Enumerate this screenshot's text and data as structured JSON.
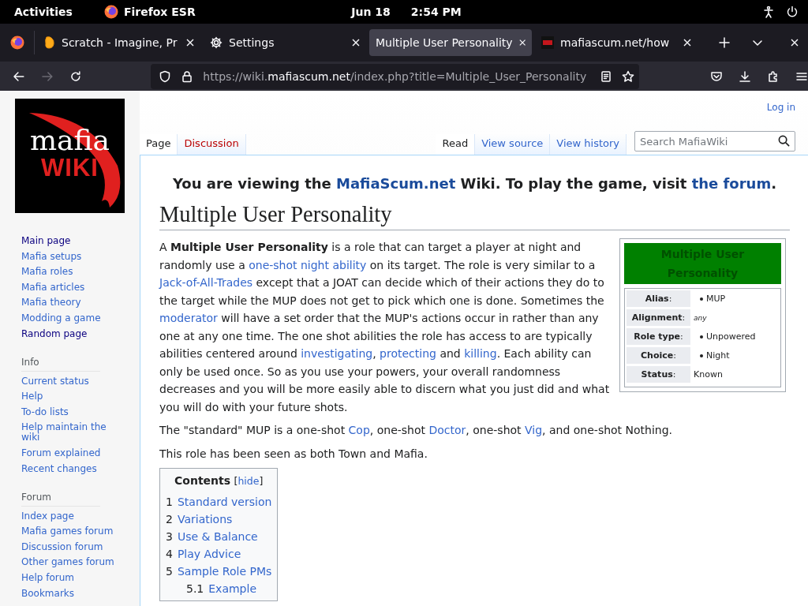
{
  "system_bar": {
    "activities": "Activities",
    "app": "Firefox ESR",
    "date": "Jun 18",
    "time": "2:54 PM"
  },
  "browser": {
    "tabs": [
      {
        "title": "Scratch - Imagine, Pr",
        "selected": false
      },
      {
        "title": "Settings",
        "selected": false
      },
      {
        "title": "Multiple User Personality",
        "selected": true
      },
      {
        "title": "mafiascum.net/how",
        "selected": false
      }
    ],
    "url": {
      "scheme": "https://wiki.",
      "domain": "mafiascum.net",
      "path": "/index.php?title=Multiple_User_Personality"
    },
    "forward_disabled": true
  },
  "wiki": {
    "logo": {
      "top": "mafia",
      "bottom": "WIKI"
    },
    "login": "Log in",
    "sidebar": [
      {
        "items": [
          {
            "label": "Main page",
            "visited": true
          },
          {
            "label": "Mafia setups",
            "visited": false
          },
          {
            "label": "Mafia roles",
            "visited": false
          },
          {
            "label": "Mafia articles",
            "visited": false
          },
          {
            "label": "Mafia theory",
            "visited": false
          },
          {
            "label": "Modding a game",
            "visited": false
          },
          {
            "label": "Random page",
            "visited": true
          }
        ]
      },
      {
        "heading": "Info",
        "items": [
          {
            "label": "Current status",
            "visited": false
          },
          {
            "label": "Help",
            "visited": false
          },
          {
            "label": "To-do lists",
            "visited": false
          },
          {
            "label": "Help maintain the wiki",
            "visited": false
          },
          {
            "label": "Forum explained",
            "visited": false
          },
          {
            "label": "Recent changes",
            "visited": false
          }
        ]
      },
      {
        "heading": "Forum",
        "items": [
          {
            "label": "Index page",
            "visited": false
          },
          {
            "label": "Mafia games forum",
            "visited": false
          },
          {
            "label": "Discussion forum",
            "visited": false
          },
          {
            "label": "Other games forum",
            "visited": false
          },
          {
            "label": "Help forum",
            "visited": false
          },
          {
            "label": "Bookmarks",
            "visited": false
          }
        ]
      }
    ],
    "page_tabs": [
      {
        "label": "Page",
        "selected": true,
        "missing": false
      },
      {
        "label": "Discussion",
        "selected": false,
        "missing": true
      }
    ],
    "view_tabs": [
      {
        "label": "Read",
        "selected": true
      },
      {
        "label": "View source",
        "selected": false
      },
      {
        "label": "View history",
        "selected": false
      }
    ],
    "search": {
      "placeholder": "Search MafiaWiki"
    },
    "banner": [
      {
        "kind": "text",
        "text": "You are viewing the "
      },
      {
        "kind": "link",
        "text": "MafiaScum.net"
      },
      {
        "kind": "text",
        "text": " Wiki. To play the game, visit "
      },
      {
        "kind": "link",
        "text": "the forum"
      },
      {
        "kind": "text",
        "text": "."
      }
    ],
    "title": "Multiple User Personality",
    "infobox": {
      "title": "Multiple User Personality",
      "rows": [
        {
          "label": "**Alias**:",
          "value": "MUP",
          "kind": "bullet"
        },
        {
          "label": "**Alignment**:",
          "value": "any",
          "kind": "italic"
        },
        {
          "label": "**Role type**:",
          "value": "Unpowered",
          "kind": "bullet"
        },
        {
          "label": "**Choice**:",
          "value": "Night",
          "kind": "bullet"
        },
        {
          "label": "**Status**:",
          "value": "Known",
          "kind": "plain"
        }
      ]
    },
    "paragraphs": [
      [
        {
          "kind": "text",
          "text": "A "
        },
        {
          "kind": "bold",
          "text": "Multiple User Personality"
        },
        {
          "kind": "text",
          "text": " is a role that can target a player at night and randomly use a "
        },
        {
          "kind": "link",
          "text": "one-shot night ability"
        },
        {
          "kind": "text",
          "text": " on its target. The role is very similar to a "
        },
        {
          "kind": "link",
          "text": "Jack-of-All-Trades"
        },
        {
          "kind": "text",
          "text": " except that a JOAT can decide which of their actions they do to the target while the MUP does not get to pick which one is done. Sometimes the "
        },
        {
          "kind": "link",
          "text": "moderator"
        },
        {
          "kind": "text",
          "text": " will have a set order that the MUP's actions occur in rather than any one at any one time. The one shot abilities the role has access to are typically abilities centered around "
        },
        {
          "kind": "link",
          "text": "investigating"
        },
        {
          "kind": "text",
          "text": ", "
        },
        {
          "kind": "link",
          "text": "protecting"
        },
        {
          "kind": "text",
          "text": " and "
        },
        {
          "kind": "link",
          "text": "killing"
        },
        {
          "kind": "text",
          "text": ". Each ability can only be used once. So as you use your powers, your overall randomness decreases and you will be more easily able to discern what you just did and what you will do with your future shots."
        }
      ],
      [
        {
          "kind": "text",
          "text": "The \"standard\" MUP is a one-shot "
        },
        {
          "kind": "link",
          "text": "Cop"
        },
        {
          "kind": "text",
          "text": ", one-shot "
        },
        {
          "kind": "link",
          "text": "Doctor"
        },
        {
          "kind": "text",
          "text": ", one-shot "
        },
        {
          "kind": "link",
          "text": "Vig"
        },
        {
          "kind": "text",
          "text": ", and one-shot Nothing."
        }
      ],
      [
        {
          "kind": "text",
          "text": "This role has been seen as both Town and Mafia."
        }
      ]
    ],
    "toc": {
      "title": "Contents",
      "toggle": [
        {
          "kind": "text",
          "text": "["
        },
        {
          "kind": "link",
          "text": "hide"
        },
        {
          "kind": "text",
          "text": "]"
        }
      ],
      "items": [
        {
          "number": "1",
          "label": "Standard version"
        },
        {
          "number": "2",
          "label": "Variations"
        },
        {
          "number": "3",
          "label": "Use & Balance"
        },
        {
          "number": "4",
          "label": "Play Advice"
        },
        {
          "number": "5",
          "label": "Sample Role PMs",
          "children": [
            {
              "number": "5.1",
              "label": "Example"
            }
          ]
        }
      ]
    }
  }
}
